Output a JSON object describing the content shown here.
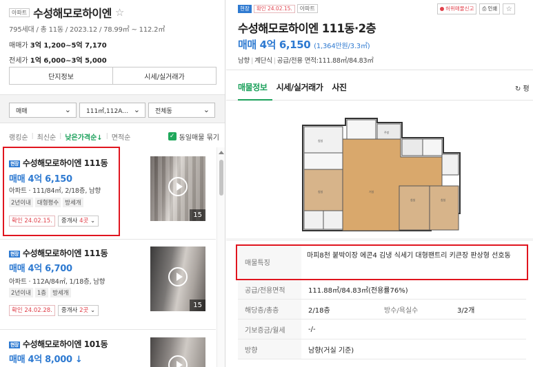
{
  "complex": {
    "type_tag": "아파트",
    "name": "수성해모로하이엔",
    "star": "☆",
    "summary": "795세대 / 총 11동 / 2023.12 / 78.99㎡ ~ 112.2㎡",
    "sale_label": "매매가",
    "sale_range": "3억 1,200~5억 7,170",
    "jeonse_label": "전세가",
    "jeonse_range": "1억 6,000~3억 5,000",
    "buttons": [
      "단지정보",
      "시세/실거래가"
    ]
  },
  "filters": {
    "trade": "매매",
    "area": "111㎡,112A...",
    "dong": "전체동"
  },
  "sort": {
    "options": [
      "랭킹순",
      "최신순",
      "낮은가격순↓",
      "면적순"
    ],
    "active_index": 2,
    "same_listing": "동일매물 묶기"
  },
  "listings": [
    {
      "badge": "현장",
      "title": "수성해모로하이엔 111동",
      "price": "매매 4억 6,150",
      "info": "아파트 · 111/84㎡, 2/18층, 남향",
      "tags": [
        "2년이내",
        "대형평수",
        "방세개"
      ],
      "confirm": "확인 24.02.15.",
      "agent_prefix": "중개사 ",
      "agent_count": "4곳",
      "photo_count": "15"
    },
    {
      "badge": "현장",
      "title": "수성해모로하이엔 111동",
      "price": "매매 4억 6,700",
      "info": "아파트 · 112A/84㎡, 1/18층, 남향",
      "tags": [
        "2년이내",
        "1층",
        "방세개"
      ],
      "confirm": "확인 24.02.28.",
      "agent_prefix": "중개사 ",
      "agent_count": "2곳",
      "photo_count": "15"
    },
    {
      "badge": "현장",
      "title": "수성해모로하이엔 101동",
      "price": "매매 4억 8,000",
      "price_arrow": "↓"
    }
  ],
  "detail": {
    "badge": "현장",
    "confirm": "확인 24.02.15.",
    "type_tag": "아파트",
    "report": "허위매물신고",
    "print": "인쇄",
    "star": "☆",
    "title": "수성해모로하이엔 111동·2층",
    "price": "매매 4억 6,150",
    "price_per": "(1,364만원/3.3㎡)",
    "meta": [
      "남향",
      "계단식",
      "공급/전용 면적:111.88㎡/84.83㎡"
    ],
    "tabs": [
      "매물정보",
      "시세/실거래가",
      "사진"
    ],
    "refresh": "↻ 평",
    "rows": [
      {
        "k": "매물특징",
        "v": "마피8천 붙박이장 에콘4 김냉 식세기 대형팬트리 키큰장 판상형 선호동"
      },
      {
        "k": "공급/전용면적",
        "v": "111.88㎡/84.83㎡(전용률76%)"
      },
      {
        "k": "해당층/총층",
        "v": "2/18층",
        "k2": "방수/욕실수",
        "v2": "3/2개"
      },
      {
        "k": "기보증금/월세",
        "v": "-/-"
      },
      {
        "k": "방향",
        "v": "남향(거실 기준)"
      }
    ]
  },
  "colors": {
    "accent_blue": "#2e7ad1",
    "accent_green": "#1aa05a",
    "highlight_red": "#e0141e"
  }
}
